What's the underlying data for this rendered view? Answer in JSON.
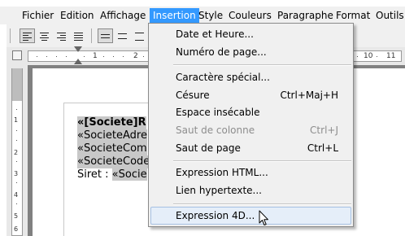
{
  "menubar": {
    "items": [
      "Fichier",
      "Edition",
      "Affichage",
      "Insertion",
      "Style",
      "Couleurs",
      "Paragraphe",
      "Format",
      "Outils"
    ],
    "active": "Insertion"
  },
  "ruler": {
    "numbers": [
      "1",
      "2",
      "10",
      "11"
    ]
  },
  "vruler": {
    "numbers": [
      "1",
      "2",
      "3",
      "4",
      "5",
      "6"
    ]
  },
  "document": {
    "line1": "«[Societe]R",
    "line2": "«SocieteAdre",
    "line3": "«SocieteCom",
    "line4": "«SocieteCode",
    "line5_label": "Siret : ",
    "line5_field": "«Socie"
  },
  "insertion_menu": {
    "items": [
      {
        "label": "Date et Heure...",
        "shortcut": ""
      },
      {
        "label": "Numéro de page...",
        "shortcut": ""
      },
      {
        "label": "Caractère spécial...",
        "shortcut": ""
      },
      {
        "label": "Césure",
        "shortcut": "Ctrl+Maj+H"
      },
      {
        "label": "Espace insécable",
        "shortcut": ""
      },
      {
        "label": "Saut de colonne",
        "shortcut": "Ctrl+J",
        "disabled": true
      },
      {
        "label": "Saut de page",
        "shortcut": "Ctrl+L"
      },
      {
        "label": "Expression HTML...",
        "shortcut": ""
      },
      {
        "label": "Lien hypertexte...",
        "shortcut": ""
      },
      {
        "label": "Expression 4D...",
        "shortcut": "",
        "highlighted": true
      }
    ]
  },
  "colors": {
    "menu_highlight": "#3399ff",
    "item_hover": "#e5eef9",
    "field_highlight": "#c8c8c8"
  }
}
